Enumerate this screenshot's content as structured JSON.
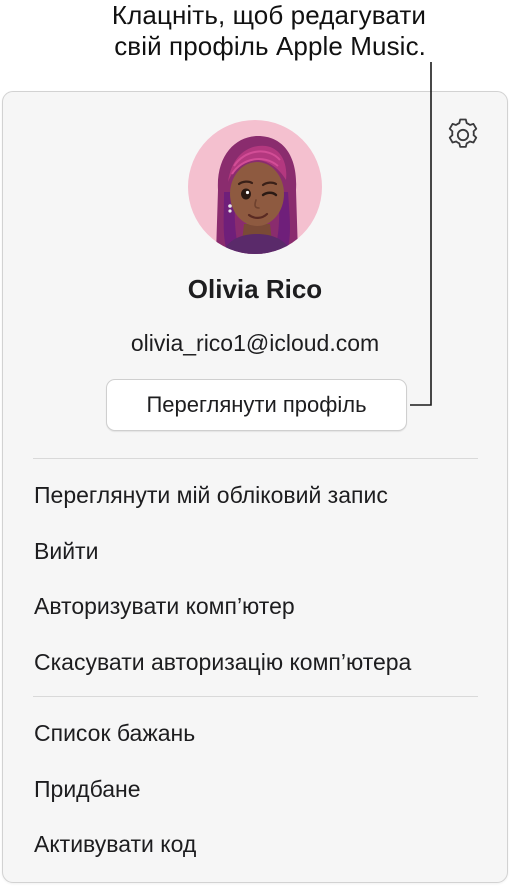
{
  "callout": {
    "line1": "Клацніть, щоб редагувати",
    "line2": "свій профіль Apple Music."
  },
  "profile": {
    "name": "Olivia Rico",
    "email": "olivia_rico1@icloud.com",
    "view_profile_label": "Переглянути профіль"
  },
  "menu": {
    "account_items": [
      {
        "label": "Переглянути мій обліковий запис"
      },
      {
        "label": "Вийти"
      },
      {
        "label": "Авторизувати комп’ютер"
      },
      {
        "label": "Скасувати авторизацію комп’ютера"
      }
    ],
    "store_items": [
      {
        "label": "Список бажань"
      },
      {
        "label": "Придбане"
      },
      {
        "label": "Активувати код"
      }
    ]
  },
  "icons": {
    "settings": "gear-icon"
  },
  "colors": {
    "panel_background": "#f6f6f6",
    "avatar_background": "#f4c0cf",
    "text": "#1d1d1f"
  }
}
